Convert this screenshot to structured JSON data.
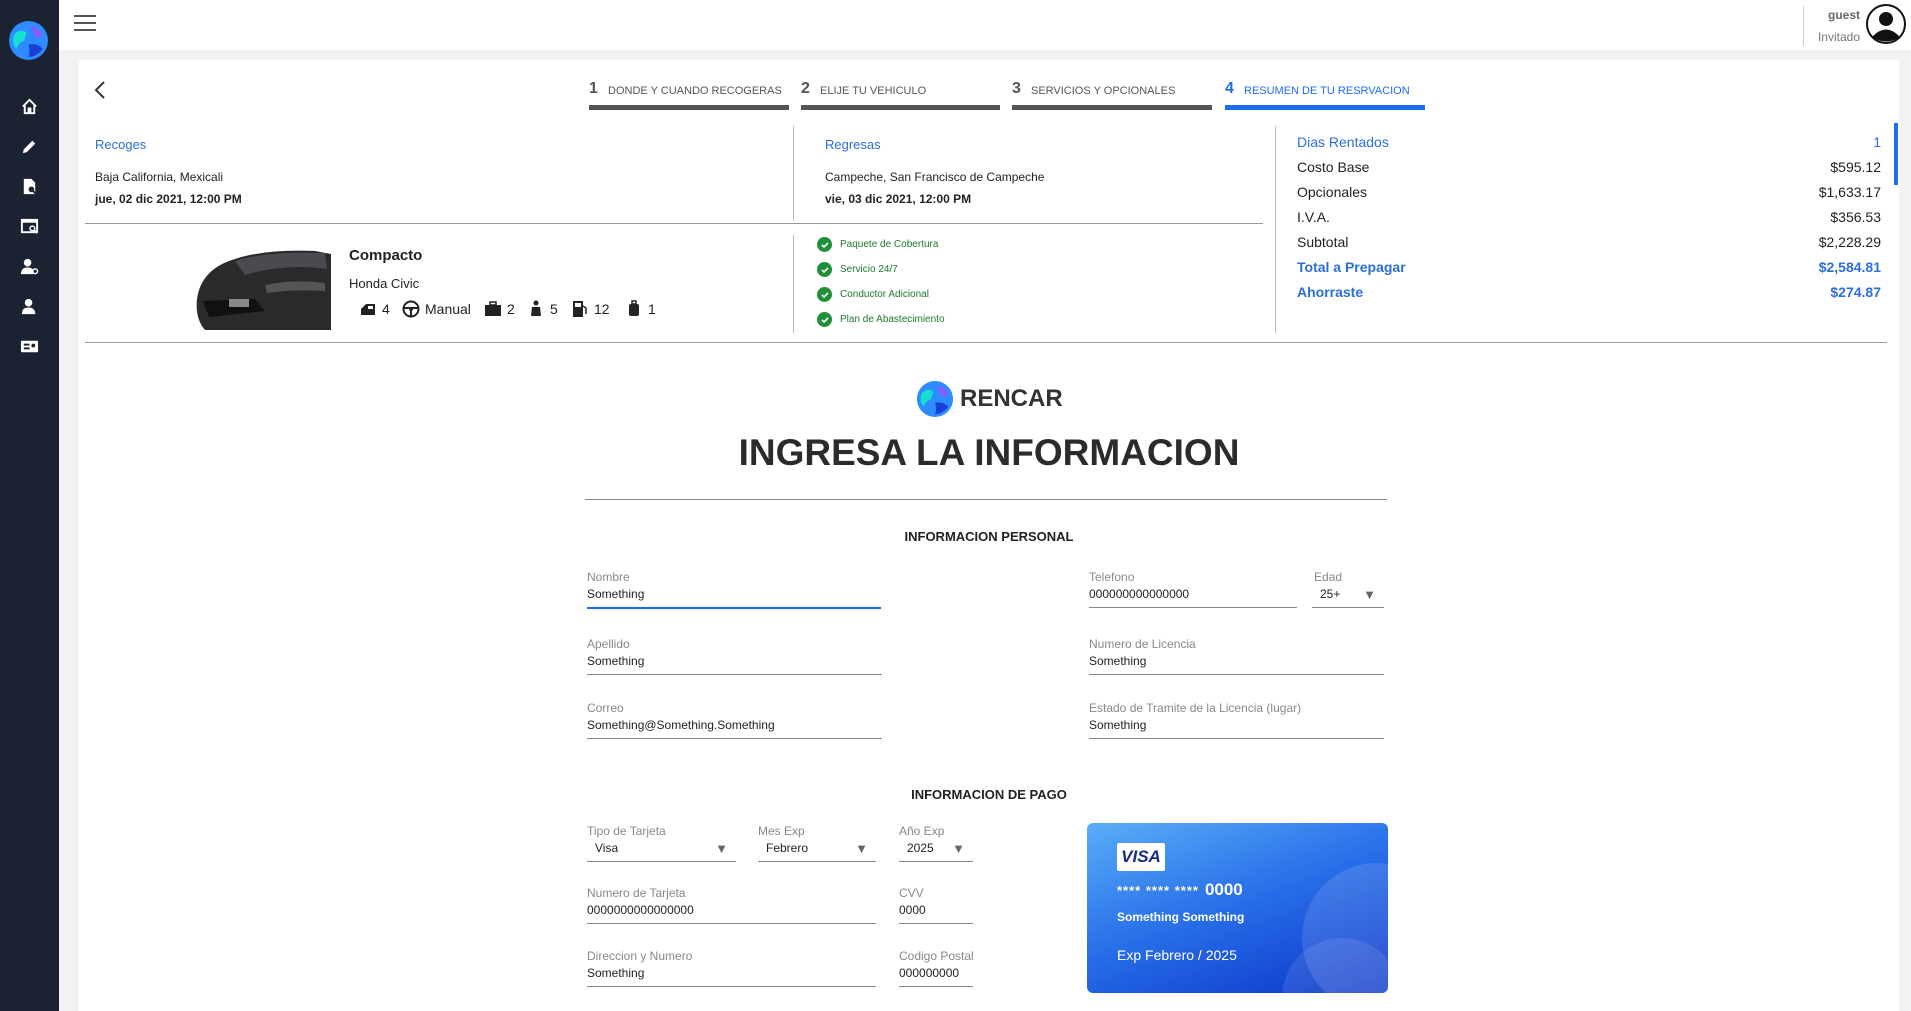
{
  "user": {
    "name": "guest",
    "role": "Invitado"
  },
  "steps": [
    {
      "num": "1",
      "label": "DONDE Y CUANDO RECOGERAS"
    },
    {
      "num": "2",
      "label": "ELIJE TU VEHICULO"
    },
    {
      "num": "3",
      "label": "SERVICIOS Y OPCIONALES"
    },
    {
      "num": "4",
      "label": "RESUMEN DE TU RESRVACION"
    }
  ],
  "pickup": {
    "label": "Recoges",
    "location": "Baja California, Mexicali",
    "date": "jue, 02 dic 2021, 12:00 PM"
  },
  "return": {
    "label": "Regresas",
    "location": "Campeche, San Francisco de Campeche",
    "date": "vie, 03 dic 2021, 12:00 PM"
  },
  "car": {
    "category": "Compacto",
    "model": "Honda Civic",
    "features": {
      "doors": "4",
      "transmission": "Manual",
      "luggage": "2",
      "seats": "5",
      "fuel": "12",
      "small_luggage": "1"
    }
  },
  "services": [
    "Paquete de Cobertura",
    "Servicio 24/7",
    "Conductor Adicional",
    "Plan de Abastecimiento"
  ],
  "summary": [
    {
      "label": "Dias Rentados",
      "value": "1"
    },
    {
      "label": "Costo Base",
      "value": "$595.12"
    },
    {
      "label": "Opcionales",
      "value": "$1,633.17"
    },
    {
      "label": "I.V.A.",
      "value": "$356.53"
    },
    {
      "label": "Subtotal",
      "value": "$2,228.29"
    },
    {
      "label": "Total a Prepagar",
      "value": "$2,584.81"
    },
    {
      "label": "Ahorraste",
      "value": "$274.87"
    }
  ],
  "brand": "RENCAR",
  "form_title": "INGRESA LA INFORMACION",
  "personal": {
    "title": "INFORMACION PERSONAL",
    "nombre": {
      "label": "Nombre",
      "value": "Something"
    },
    "apellido": {
      "label": "Apellido",
      "value": "Something"
    },
    "correo": {
      "label": "Correo",
      "value": "Something@Something.Something"
    },
    "telefono": {
      "label": "Telefono",
      "value": "000000000000000"
    },
    "edad": {
      "label": "Edad",
      "value": "25+"
    },
    "licencia": {
      "label": "Numero de Licencia",
      "value": "Something"
    },
    "estado_licencia": {
      "label": "Estado de Tramite de la Licencia (lugar)",
      "value": "Something"
    }
  },
  "payment": {
    "title": "INFORMACION DE PAGO",
    "tipo": {
      "label": "Tipo de Tarjeta",
      "value": "Visa"
    },
    "mes": {
      "label": "Mes Exp",
      "value": "Febrero"
    },
    "anio": {
      "label": "Año Exp",
      "value": "2025"
    },
    "numero": {
      "label": "Numero de Tarjeta",
      "value": "0000000000000000"
    },
    "cvv": {
      "label": "CVV",
      "value": "0000"
    },
    "direccion": {
      "label": "Direccion y Numero",
      "value": "Something"
    },
    "postal": {
      "label": "Codigo Postal",
      "value": "000000000"
    }
  },
  "card_preview": {
    "brand": "VISA",
    "mask": "**** **** ****",
    "last4": "0000",
    "holder": "Something  Something",
    "exp_prefix": "Exp",
    "exp_month": "Febrero /",
    "exp_year": "2025"
  },
  "colors": {
    "accent": "#1c6df0",
    "sidebar": "#1b2231",
    "success": "#1f8f3a"
  }
}
